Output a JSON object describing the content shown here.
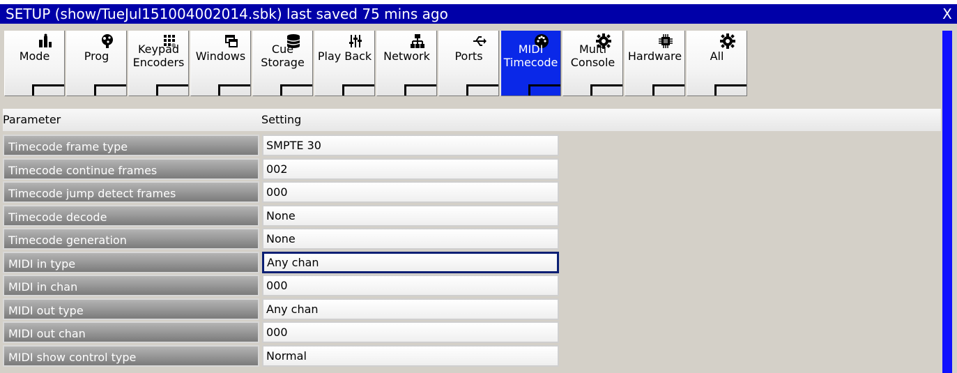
{
  "window": {
    "title": "SETUP (show/TueJul151004002014.sbk) last saved 75 mins ago",
    "close_label": "X"
  },
  "tabs": [
    {
      "label": "Mode",
      "icon": "mode-icon"
    },
    {
      "label": "Prog",
      "icon": "prog-icon"
    },
    {
      "label": "Keypad\nEncoders",
      "icon": "keypad-icon"
    },
    {
      "label": "Windows",
      "icon": "windows-icon"
    },
    {
      "label": "Cue Storage",
      "icon": "database-icon"
    },
    {
      "label": "Play Back",
      "icon": "faders-icon"
    },
    {
      "label": "Network",
      "icon": "network-icon"
    },
    {
      "label": "Ports",
      "icon": "usb-icon"
    },
    {
      "label": "MIDI\nTimecode",
      "icon": "midi-icon",
      "active": true
    },
    {
      "label": "Multi\nConsole",
      "icon": "gear-icon"
    },
    {
      "label": "Hardware",
      "icon": "chip-icon"
    },
    {
      "label": "All",
      "icon": "gear-icon"
    }
  ],
  "table": {
    "headers": {
      "parameter": "Parameter",
      "setting": "Setting"
    },
    "rows": [
      {
        "name": "Timecode frame type",
        "value": "SMPTE 30"
      },
      {
        "name": "Timecode continue frames",
        "value": "002"
      },
      {
        "name": "Timecode jump detect frames",
        "value": "000"
      },
      {
        "name": "Timecode decode",
        "value": "None"
      },
      {
        "name": "Timecode generation",
        "value": "None"
      },
      {
        "name": "MIDI in type",
        "value": "Any chan",
        "focused": true
      },
      {
        "name": "MIDI in chan",
        "value": "000"
      },
      {
        "name": "MIDI out type",
        "value": "Any chan"
      },
      {
        "name": "MIDI out chan",
        "value": "000"
      },
      {
        "name": "MIDI show control type",
        "value": "Normal"
      }
    ]
  },
  "colors": {
    "titlebar": "#0000a8",
    "active_tab": "#0a28e8",
    "scrollbar": "#1010ff"
  }
}
